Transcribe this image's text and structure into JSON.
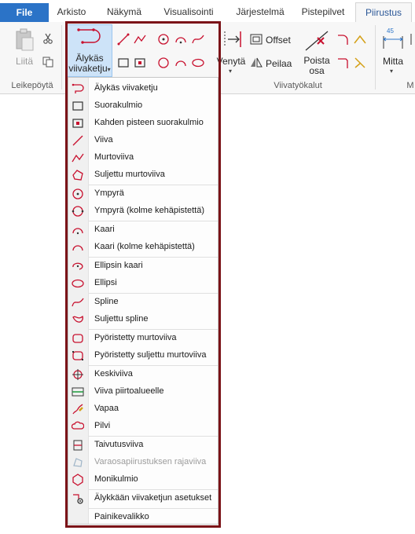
{
  "tabs": {
    "file": "File",
    "items": [
      "Arkisto",
      "Näkymä",
      "Visualisointi",
      "Järjestelmä",
      "Pistepilvet",
      "Piirustus"
    ],
    "active": "Piirustus"
  },
  "ribbon": {
    "clipboard": {
      "paste_label": "Liitä",
      "group_label": "Leikepöytä"
    },
    "smart_polyline": {
      "label_line1": "Älykäs",
      "label_line2": "viivaketju",
      "arrow": "▾"
    },
    "tools": {
      "extend_label": "Venytä",
      "offset_label": "Offset",
      "mirror_label": "Peilaa",
      "remove_label_line1": "Poista",
      "remove_label_line2": "osa",
      "group_label": "Viivatyökalut"
    },
    "dimension": {
      "label": "Mitta",
      "value_badge": "45",
      "group_label_partial": "M"
    }
  },
  "menu": {
    "groups": [
      [
        {
          "label": "Älykäs viivaketju",
          "icon": "smart-polyline-icon"
        },
        {
          "label": "Suorakulmio",
          "icon": "rectangle-icon"
        },
        {
          "label": "Kahden pisteen suorakulmio",
          "icon": "two-point-rectangle-icon"
        },
        {
          "label": "Viiva",
          "icon": "line-icon"
        },
        {
          "label": "Murtoviiva",
          "icon": "polyline-icon"
        },
        {
          "label": "Suljettu murtoviiva",
          "icon": "closed-polyline-icon"
        }
      ],
      [
        {
          "label": "Ympyrä",
          "icon": "circle-icon"
        },
        {
          "label": "Ympyrä (kolme kehäpistettä)",
          "icon": "circle-three-point-icon"
        }
      ],
      [
        {
          "label": "Kaari",
          "icon": "arc-icon"
        },
        {
          "label": "Kaari (kolme kehäpistettä)",
          "icon": "arc-three-point-icon"
        }
      ],
      [
        {
          "label": "Ellipsin kaari",
          "icon": "ellipse-arc-icon"
        },
        {
          "label": "Ellipsi",
          "icon": "ellipse-icon"
        }
      ],
      [
        {
          "label": "Spline",
          "icon": "spline-icon"
        },
        {
          "label": "Suljettu spline",
          "icon": "closed-spline-icon"
        }
      ],
      [
        {
          "label": "Pyöristetty murtoviiva",
          "icon": "rounded-polyline-icon"
        },
        {
          "label": "Pyöristetty suljettu murtoviiva",
          "icon": "rounded-closed-polyline-icon"
        }
      ],
      [
        {
          "label": "Keskiviiva",
          "icon": "centerline-icon"
        },
        {
          "label": "Viiva piirtoalueelle",
          "icon": "line-to-drawing-area-icon"
        },
        {
          "label": "Vapaa",
          "icon": "freehand-icon"
        },
        {
          "label": "Pilvi",
          "icon": "cloud-icon"
        }
      ],
      [
        {
          "label": "Taivutusviiva",
          "icon": "bend-line-icon"
        },
        {
          "label": "Varaosapiirustuksen rajaviiva",
          "icon": "spare-part-boundary-icon",
          "disabled": true
        },
        {
          "label": "Monikulmio",
          "icon": "polygon-icon"
        }
      ],
      [
        {
          "label": "Älykkään viivaketjun asetukset",
          "icon": "smart-polyline-settings-icon"
        }
      ],
      [
        {
          "label": "Painikevalikko",
          "icon": ""
        }
      ]
    ]
  },
  "colors": {
    "file_tab": "#2b73c7",
    "drawing_red": "#c8102e",
    "highlight_frame": "#7b1318",
    "selected_button": "#cde3f8",
    "active_tab_text": "#2b5797"
  }
}
